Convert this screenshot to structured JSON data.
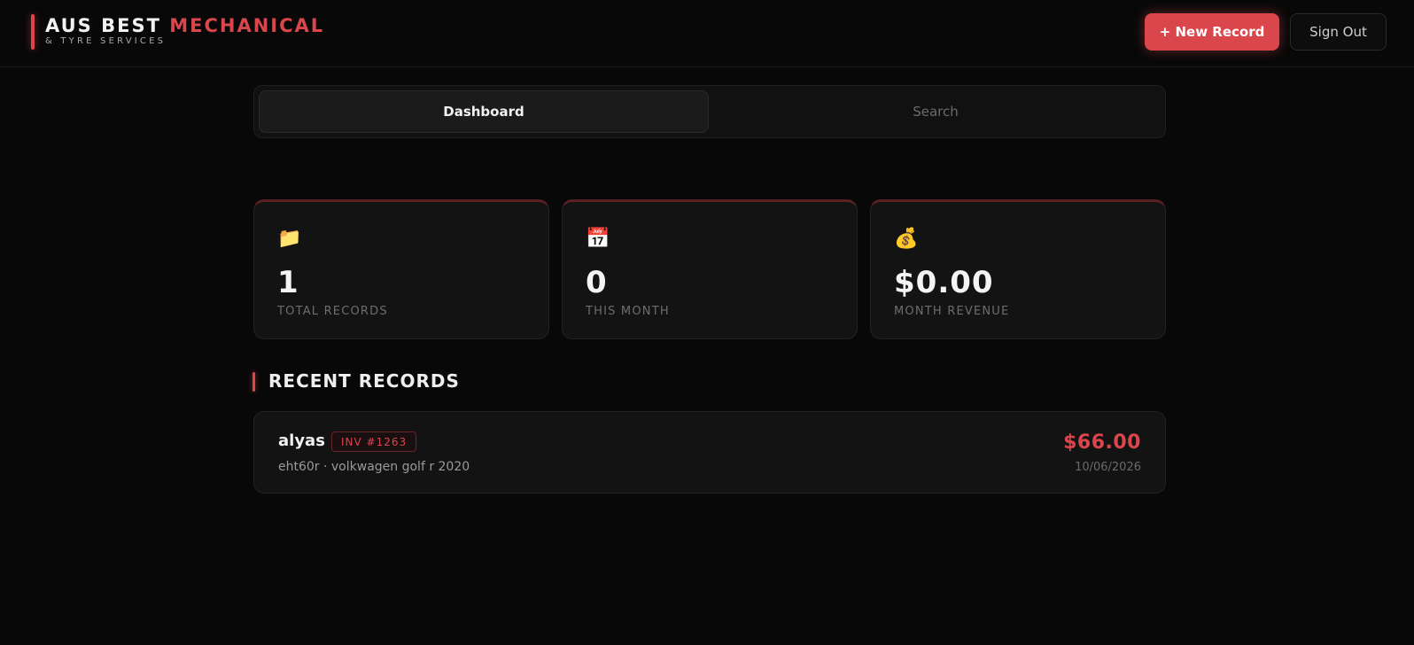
{
  "brand": {
    "title_white": "AUS BEST",
    "title_red": "MECHANICAL",
    "subtitle": "& TYRE SERVICES"
  },
  "header": {
    "new_record_label": "+ New Record",
    "sign_out_label": "Sign Out"
  },
  "tabs": [
    {
      "label": "Dashboard",
      "active": true
    },
    {
      "label": "Search",
      "active": false
    }
  ],
  "stats": [
    {
      "icon": "📁",
      "icon_name": "folder-icon",
      "value": "1",
      "label": "TOTAL RECORDS"
    },
    {
      "icon": "📅",
      "icon_name": "calendar-icon",
      "value": "0",
      "label": "THIS MONTH"
    },
    {
      "icon": "💰",
      "icon_name": "money-bag-icon",
      "value": "$0.00",
      "label": "MONTH REVENUE"
    }
  ],
  "recent": {
    "title": "RECENT RECORDS",
    "records": [
      {
        "name": "alyas",
        "invoice": "INV #1263",
        "vehicle": "eht60r · volkwagen golf r 2020",
        "amount": "$66.00",
        "date": "10/06/2026"
      }
    ]
  },
  "colors": {
    "accent": "#d9464b",
    "background": "#080808",
    "card": "#131313"
  }
}
